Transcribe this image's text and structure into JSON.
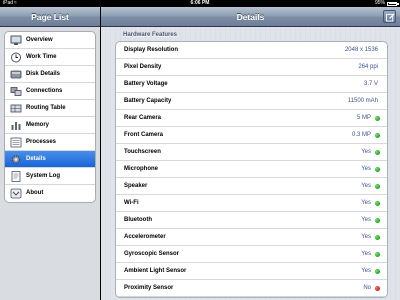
{
  "status_bar": {
    "carrier": "iPad",
    "time": "6:06 PM",
    "battery": "95%",
    "battery_level": 0.95
  },
  "left_pane": {
    "title": "Page List",
    "items": [
      {
        "label": "Overview",
        "icon": "monitor-icon",
        "selected": false
      },
      {
        "label": "Work Time",
        "icon": "clock-icon",
        "selected": false
      },
      {
        "label": "Disk Details",
        "icon": "disk-icon",
        "selected": false
      },
      {
        "label": "Connections",
        "icon": "connections-icon",
        "selected": false
      },
      {
        "label": "Routing Table",
        "icon": "routing-icon",
        "selected": false
      },
      {
        "label": "Memory",
        "icon": "memory-chart-icon",
        "selected": false
      },
      {
        "label": "Processes",
        "icon": "processes-icon",
        "selected": false
      },
      {
        "label": "Details",
        "icon": "gear-icon",
        "selected": true
      },
      {
        "label": "System Log",
        "icon": "log-icon",
        "selected": false
      },
      {
        "label": "About",
        "icon": "info-icon",
        "selected": false
      }
    ]
  },
  "right_pane": {
    "title": "Details",
    "compose_icon": "compose-icon",
    "section_title": "Hardware Features",
    "rows": [
      {
        "label": "Display Resolution",
        "value": "2048 x 1536",
        "status": null
      },
      {
        "label": "Pixel Density",
        "value": "264 ppi",
        "status": null
      },
      {
        "label": "Battery Voltage",
        "value": "3.7 V",
        "status": null
      },
      {
        "label": "Battery Capacity",
        "value": "11500 mAh",
        "status": null
      },
      {
        "label": "Rear Camera",
        "value": "5 MP",
        "status": "green"
      },
      {
        "label": "Front Camera",
        "value": "0.3 MP",
        "status": "green"
      },
      {
        "label": "Touchscreen",
        "value": "Yes",
        "status": "green"
      },
      {
        "label": "Microphone",
        "value": "Yes",
        "status": "green"
      },
      {
        "label": "Speaker",
        "value": "Yes",
        "status": "green"
      },
      {
        "label": "Wi-Fi",
        "value": "Yes",
        "status": "green"
      },
      {
        "label": "Bluetooth",
        "value": "Yes",
        "status": "green"
      },
      {
        "label": "Accelerometer",
        "value": "Yes",
        "status": "green"
      },
      {
        "label": "Gyroscopic Sensor",
        "value": "Yes",
        "status": "green"
      },
      {
        "label": "Ambient Light Sensor",
        "value": "Yes",
        "status": "green"
      },
      {
        "label": "Proximity Sensor",
        "value": "No",
        "status": "red"
      }
    ]
  },
  "colors": {
    "selected": "#1f6fe0",
    "value_text": "#3b5489",
    "ok": "#17a31a",
    "bad": "#c51b0e"
  }
}
